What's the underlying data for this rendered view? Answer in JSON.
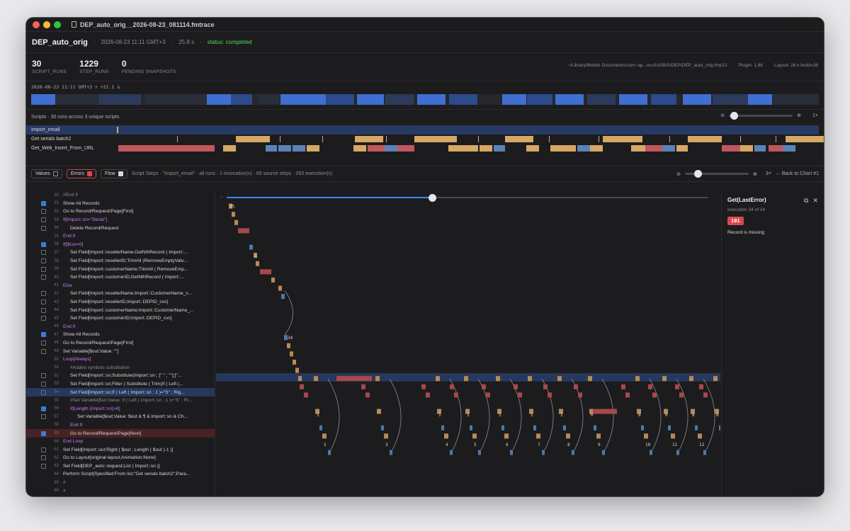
{
  "window": {
    "title": "DEP_auto_orig__2026-08-23_081114.fmtrace"
  },
  "header": {
    "name": "DEP_auto_orig",
    "datetime": "2026-08-23 11:11 GMT+3",
    "sep": "·",
    "duration": "25.8 s",
    "status": "status: completed"
  },
  "stats": [
    {
      "value": "30",
      "label": "SCRIPT_RUNS"
    },
    {
      "value": "1229",
      "label": "STEP_RUNS"
    },
    {
      "value": "0",
      "label": "PENDING SNAPSHOTS"
    }
  ],
  "meta": {
    "path": "~/Library/Mobile Documents/com~ap...ocs/IASBIS/DEP/DEP_auto_orig.fmp12",
    "plugin": "Plugin: 1.86",
    "layout": "Layout: 26.x build=38"
  },
  "timeline": {
    "label": "2026-08-23 11:11 GMT+3 + +21.1 s"
  },
  "scripts": {
    "summary": "Scripts · 30 runs across 3 unique scripts",
    "zoom_label": "1×",
    "rows": [
      {
        "name": "Import_email",
        "selected": true
      },
      {
        "name": "Get serials batch2",
        "selected": false
      },
      {
        "name": "Get_Web_Insert_From_URL",
        "selected": false
      }
    ]
  },
  "toolbar": {
    "values": "Values",
    "errors": "Errors",
    "flow": "Flow",
    "steps_info": "Script Steps · \"Import_email\" · all runs · 1 invocation(s) · 66 source steps · 283 execution(s)",
    "zoom_label": "3×",
    "back": "← Back to Chart #1"
  },
  "graph": {
    "scrub_label": "↔"
  },
  "inspector": {
    "title": "Get(LastError)",
    "subtitle": "execution 34 of 34",
    "code": "101",
    "message": "Record is missing"
  },
  "code_lines": [
    {
      "n": "30",
      "t": "//End If",
      "indent": 0,
      "check": "",
      "cls": "k-gray"
    },
    {
      "n": "31",
      "t": "Show All Records",
      "indent": 0,
      "check": "on",
      "cls": ""
    },
    {
      "n": "32",
      "t": "Go to Record/Request/Page[First]",
      "indent": 0,
      "check": "off",
      "cls": ""
    },
    {
      "n": "33",
      "t": "If[Import::sn=\"Serial\"]",
      "indent": 0,
      "check": "off",
      "cls": "k-purple"
    },
    {
      "n": "34",
      "t": "Delete Record/Request",
      "indent": 1,
      "check": "off",
      "cls": ""
    },
    {
      "n": "35",
      "t": "End If",
      "indent": 0,
      "check": "",
      "cls": "k-purple"
    },
    {
      "n": "36",
      "t": "If[$csv=0]",
      "indent": 0,
      "check": "on",
      "cls": "k-purple"
    },
    {
      "n": "37",
      "t": "Set Field[Import::resellerName;GetNthRecord ( Import::...",
      "indent": 1,
      "check": "off",
      "cls": ""
    },
    {
      "n": "38",
      "t": "Set Field[Import::resellerID;TrimAll (RemoveEmptyValu...",
      "indent": 1,
      "check": "off",
      "cls": ""
    },
    {
      "n": "39",
      "t": "Set Field[Import::customerName;TrimAll ( RemoveEmp...",
      "indent": 1,
      "check": "off",
      "cls": ""
    },
    {
      "n": "40",
      "t": "Set Field[Import::customerID;GetNthRecord ( Import::...",
      "indent": 1,
      "check": "off",
      "cls": ""
    },
    {
      "n": "41",
      "t": "Else",
      "indent": 0,
      "check": "",
      "cls": "k-purple"
    },
    {
      "n": "42",
      "t": "Set Field[Import::resellerName;Import::CustomerName_c...",
      "indent": 1,
      "check": "off",
      "cls": ""
    },
    {
      "n": "43",
      "t": "Set Field[Import::resellerID;Import::DEPID_cvs]",
      "indent": 1,
      "check": "off",
      "cls": ""
    },
    {
      "n": "44",
      "t": "Set Field[Import::customerName;Import::CustomerName_...",
      "indent": 1,
      "check": "off",
      "cls": ""
    },
    {
      "n": "45",
      "t": "Set Field[Import::customerID;Import::DEPID_cvs]",
      "indent": 1,
      "check": "off",
      "cls": ""
    },
    {
      "n": "46",
      "t": "End If",
      "indent": 0,
      "check": "",
      "cls": "k-purple"
    },
    {
      "n": "47",
      "t": "Show All Records",
      "indent": 0,
      "check": "on",
      "cls": ""
    },
    {
      "n": "48",
      "t": "Go to Record/Request/Page[First]",
      "indent": 0,
      "check": "off",
      "cls": ""
    },
    {
      "n": "49",
      "t": "Set Variable[$out;Value: \"\"]",
      "indent": 0,
      "check": "off",
      "cls": ""
    },
    {
      "n": "50",
      "t": "Loop[Always]",
      "indent": 0,
      "check": "",
      "cls": "k-purple"
    },
    {
      "n": "51",
      "t": "#Added symbols substitution",
      "indent": 1,
      "check": "",
      "cls": "k-gray"
    },
    {
      "n": "52",
      "t": "Set Field[Import::sn;Substitute(Import::sn ; [\" \" ; \"\"];[\"...",
      "indent": 1,
      "check": "off",
      "cls": ""
    },
    {
      "n": "53",
      "t": "Set Field[Import::sn;Filter ( Substitute ( Trim(If ( Left (...",
      "indent": 1,
      "check": "off",
      "cls": ""
    },
    {
      "n": "54",
      "t": "Set Field[Import::sn;If ( Left ( Import::sn ; 1 )=\"S\" ; Rig...",
      "indent": 1,
      "check": "off",
      "cls": "",
      "hl": "hl"
    },
    {
      "n": "55",
      "t": "//Set Variable[$sn;Value: If ( Left ( Import::sn ; 1 )=\"S\" ; Ri...",
      "indent": 1,
      "check": "",
      "cls": "k-gray"
    },
    {
      "n": "56",
      "t": "If[Length (Import::sn)>8]",
      "indent": 1,
      "check": "on",
      "cls": "k-purple"
    },
    {
      "n": "57",
      "t": "Set Variable[$out;Value: $out & ¶ & Import::sn & Ch...",
      "indent": 2,
      "check": "off",
      "cls": ""
    },
    {
      "n": "58",
      "t": "End If",
      "indent": 1,
      "check": "",
      "cls": "k-purple"
    },
    {
      "n": "59",
      "t": "Go to Record/Request/Page[Next]",
      "indent": 1,
      "check": "on",
      "cls": "",
      "hl": "err"
    },
    {
      "n": "60",
      "t": "End Loop",
      "indent": 0,
      "check": "",
      "cls": "k-purple"
    },
    {
      "n": "61",
      "t": "Set Field[Import::out;Right ( $out ; Length ( $out )-1 )]",
      "indent": 0,
      "check": "off",
      "cls": ""
    },
    {
      "n": "62",
      "t": "Go to Layout[original layout;Animation:None]",
      "indent": 0,
      "check": "off",
      "cls": ""
    },
    {
      "n": "63",
      "t": "Set Field[DEP_auto::request;List ( Import::sn )]",
      "indent": 0,
      "check": "off",
      "cls": ""
    },
    {
      "n": "64",
      "t": "Perform Script[Specified:From list;\"Get serials batch2\";Para...",
      "indent": 0,
      "check": "",
      "cls": ""
    },
    {
      "n": "65",
      "t": "#",
      "indent": 0,
      "check": "",
      "cls": "k-gray"
    },
    {
      "n": "66",
      "t": "#",
      "indent": 0,
      "check": "",
      "cls": "k-gray"
    }
  ],
  "colors": {
    "blue": "#3f6fd0",
    "dark_blue": "#2c4a8c",
    "orange": "#d6a865",
    "red": "#c0575c",
    "steel": "#5b83b8",
    "tan": "#b08a5a"
  }
}
